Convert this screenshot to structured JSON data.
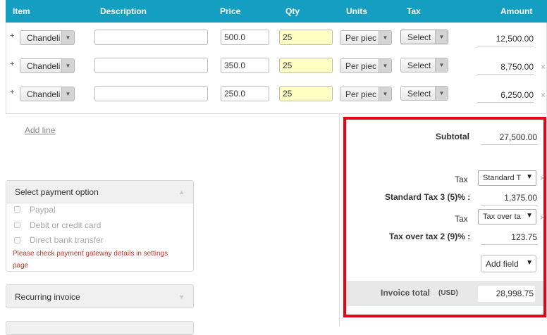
{
  "columns": {
    "item": "Item",
    "description": "Description",
    "price": "Price",
    "qty": "Qty",
    "units": "Units",
    "tax": "Tax",
    "amount": "Amount"
  },
  "lines": [
    {
      "plus": "+",
      "item": "Chandeli",
      "description": "",
      "price": "500.0",
      "qty": "25",
      "units": "Per piec",
      "tax": "Select",
      "amount": "12,500.00",
      "remove": ""
    },
    {
      "plus": "+",
      "item": "Chandeli",
      "description": "",
      "price": "350.0",
      "qty": "25",
      "units": "Per piec",
      "tax": "Select",
      "amount": "8,750.00",
      "remove": "×"
    },
    {
      "plus": "+",
      "item": "Chandeli",
      "description": "",
      "price": "250.0",
      "qty": "25",
      "units": "Per piec",
      "tax": "Select",
      "amount": "6,250.00",
      "remove": "×"
    }
  ],
  "add_line": "Add line",
  "payment": {
    "title": "Select payment option",
    "options": [
      "Paypal",
      "Debit or credit card",
      "Direct bank transfer"
    ],
    "warning_line1": "Please check payment gateway details in settings",
    "warning_line2": "page"
  },
  "recurring": {
    "title": "Recurring invoice"
  },
  "totals": {
    "subtotal_label": "Subtotal",
    "subtotal_value": "27,500.00",
    "tax_label": "Tax",
    "tax1_select": "Standard T",
    "tax1_label": "Standard Tax 3 (5)% :",
    "tax1_value": "1,375.00",
    "tax2_select": "Tax over ta",
    "tax2_label": "Tax over tax 2 (9)% :",
    "tax2_value": "123.75",
    "add_field": "Add field",
    "invoice_total_label": "Invoice total",
    "currency": "(USD)",
    "invoice_total_value": "28,998.75"
  },
  "colors": {
    "header_bg": "#149fc2",
    "highlight_box": "#e30613",
    "qty_bg": "#ffffc4"
  }
}
